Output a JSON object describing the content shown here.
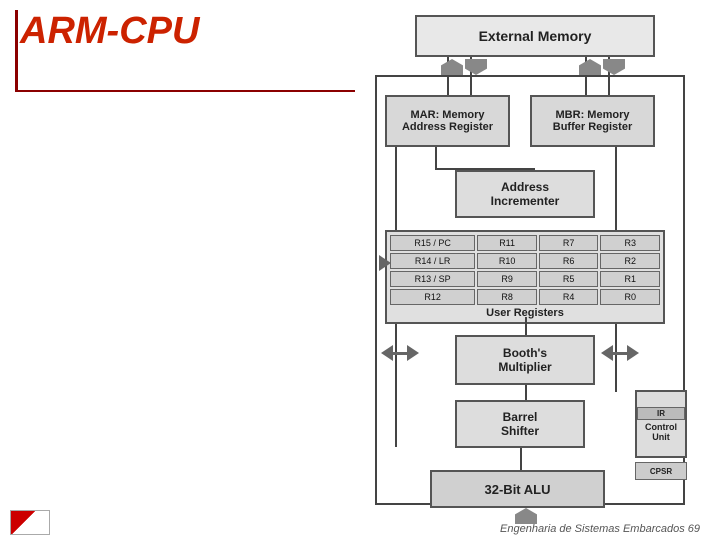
{
  "title": {
    "text": "ARM-CPU"
  },
  "diagram": {
    "external_memory": "External Memory",
    "mar": "MAR: Memory\nAddress Register",
    "mbr": "MBR: Memory\nBuffer Register",
    "addr_incrementer": "Address\nIncrementer",
    "user_registers": "User Registers",
    "booths_multiplier": "Booth's\nMultiplier",
    "barrel_shifter": "Barrel\nShifter",
    "alu": "32-Bit ALU",
    "control_unit": "Control\nUnit",
    "ir": "IR",
    "cpsr": "CPSR",
    "registers": {
      "row1": [
        "R15 / PC",
        "R11",
        "R7",
        "R3"
      ],
      "row2": [
        "R14 / LR",
        "R10",
        "R6",
        "R2"
      ],
      "row3": [
        "R13 / SP",
        "R9",
        "R5",
        "R1"
      ],
      "row4": [
        "R12",
        "R8",
        "R4",
        "R0"
      ]
    }
  },
  "footer": {
    "text": "Engenharia de Sistemas Embarcados 69"
  }
}
